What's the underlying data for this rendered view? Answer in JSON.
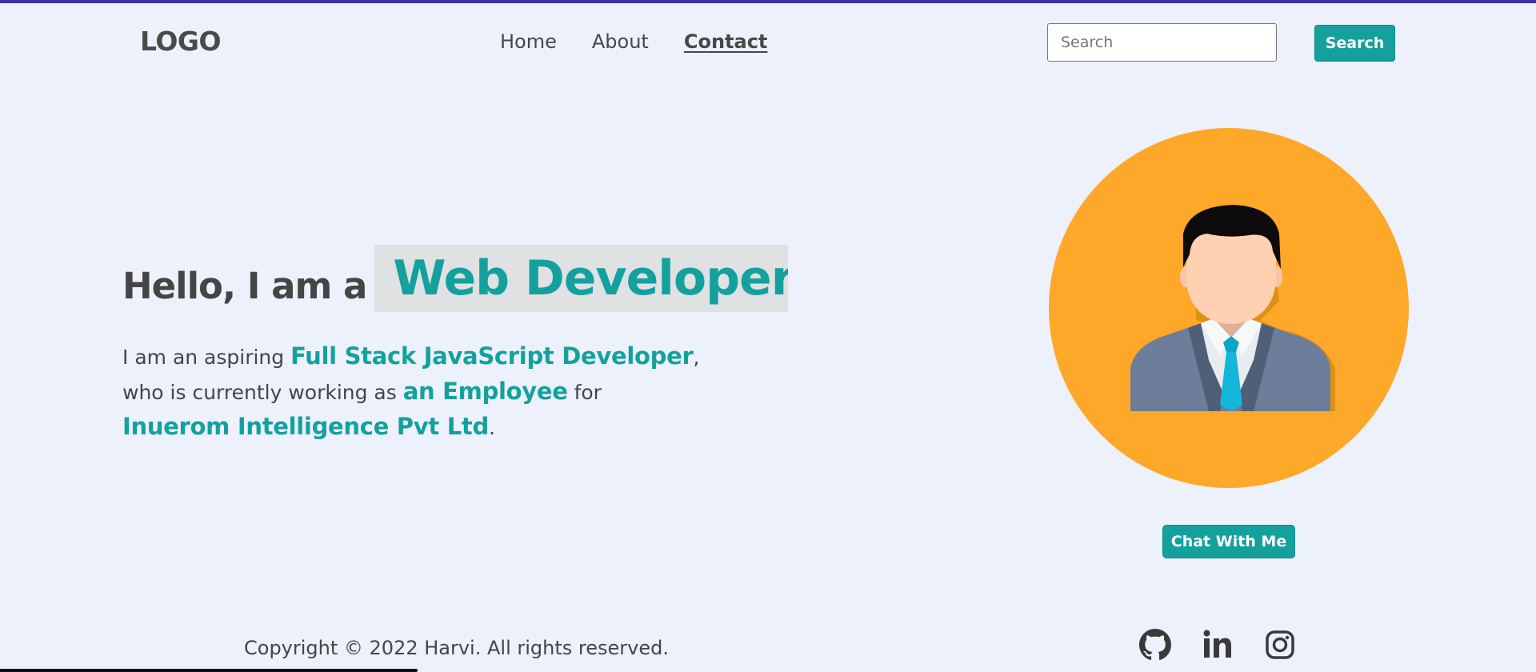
{
  "header": {
    "logo": "LOGO",
    "nav": [
      {
        "label": "Home",
        "active": false
      },
      {
        "label": "About",
        "active": false
      },
      {
        "label": "Contact",
        "active": true
      }
    ],
    "search": {
      "placeholder": "Search",
      "value": "",
      "button_label": "Search"
    }
  },
  "hero": {
    "prefix": "Hello, I am a",
    "role": "Web Developer",
    "intro": {
      "p1": "I am an aspiring ",
      "h1": "Full Stack JavaScript Developer",
      "p2": ",",
      "p3": "who is currently working as ",
      "h2": "an Employee",
      "p4": " for",
      "h3": "Inuerom Intelligence Pvt Ltd",
      "p5": "."
    },
    "chat_button": "Chat With Me"
  },
  "footer": {
    "copyright": "Copyright © 2022 Harvi. All rights reserved.",
    "social": [
      "github-icon",
      "linkedin-icon",
      "instagram-icon"
    ]
  },
  "colors": {
    "accent": "#14a19e",
    "background": "#ecf1fc",
    "avatar_bg": "#fea82a",
    "top_line": "#3d34a6"
  }
}
